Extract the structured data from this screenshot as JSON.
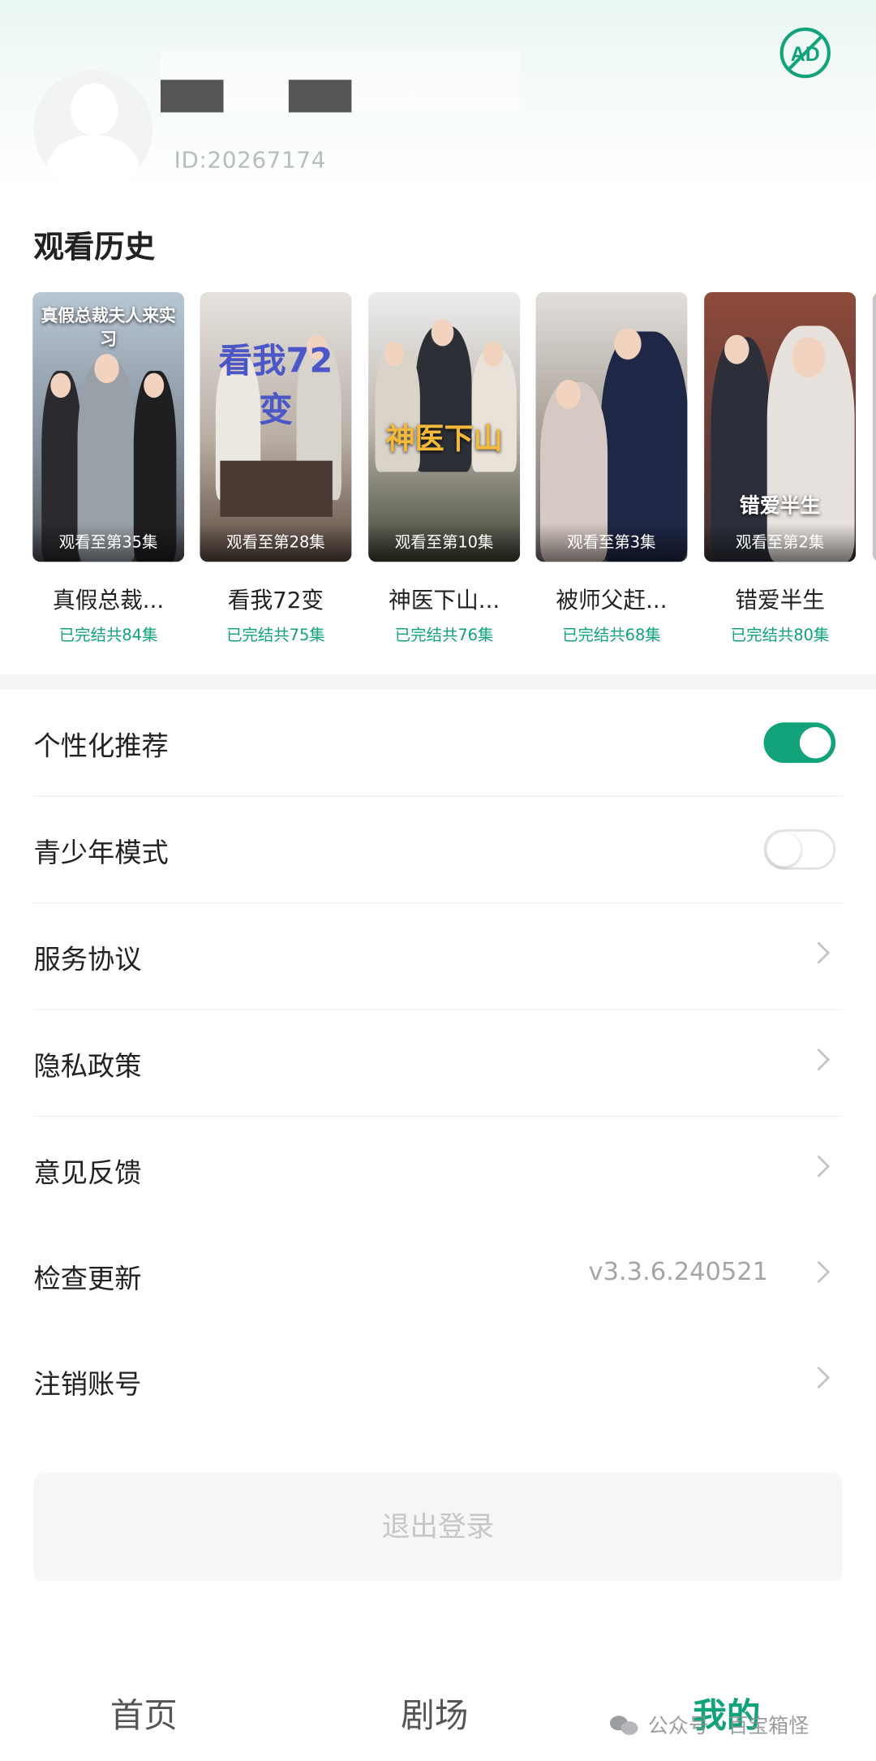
{
  "header": {
    "user_id": "ID:20267174",
    "ad_icon": "no-ads-icon",
    "ad_label": "AD"
  },
  "history": {
    "title": "观看历史",
    "items": [
      {
        "poster_title": "真假总裁夫人来实习",
        "progress": "观看至第35集",
        "title": "真假总裁...",
        "status": "已完结共84集"
      },
      {
        "poster_title": "看我72变",
        "progress": "观看至第28集",
        "title": "看我72变",
        "status": "已完结共75集"
      },
      {
        "poster_title": "神医下山",
        "progress": "观看至第10集",
        "title": "神医下山...",
        "status": "已完结共76集"
      },
      {
        "poster_title": "",
        "progress": "观看至第3集",
        "title": "被师父赶...",
        "status": "已完结共68集"
      },
      {
        "poster_title": "错爱半生",
        "progress": "观看至第2集",
        "title": "错爱半生",
        "status": "已完结共80集"
      }
    ]
  },
  "settings": {
    "personalized": {
      "label": "个性化推荐",
      "enabled": true
    },
    "teen_mode": {
      "label": "青少年模式",
      "enabled": false
    },
    "service": {
      "label": "服务协议"
    },
    "privacy": {
      "label": "隐私政策"
    },
    "feedback": {
      "label": "意见反馈"
    },
    "update": {
      "label": "检查更新",
      "value": "v3.3.6.240521"
    },
    "cancel": {
      "label": "注销账号"
    }
  },
  "logout_label": "退出登录",
  "nav": {
    "home": "首页",
    "theater": "剧场",
    "mine": "我的"
  },
  "watermark": "公众号 · 百宝箱怪",
  "colors": {
    "accent": "#12a37a"
  }
}
